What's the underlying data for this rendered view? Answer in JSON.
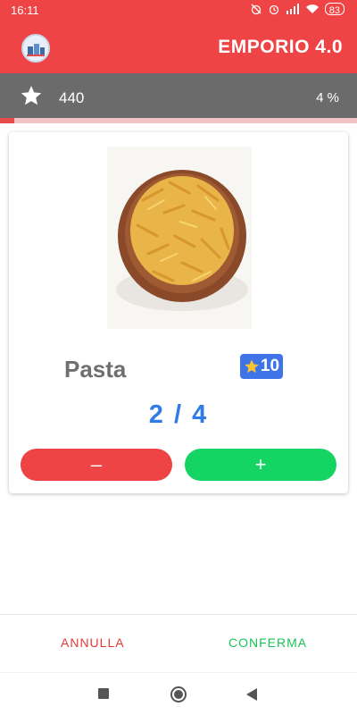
{
  "status_bar": {
    "time": "16:11",
    "battery": "83"
  },
  "app_bar": {
    "title": "EMPORIO 4.0",
    "logo_icon": "emporio-logo-icon"
  },
  "score_bar": {
    "points": "440",
    "percent": "4 %",
    "progress_fraction": 0.04,
    "star_icon": "star-icon"
  },
  "product": {
    "image": "pasta-bowl-image",
    "name": "Pasta",
    "points_badge": "10",
    "quantity": "2 / 4",
    "minus_label": "–",
    "plus_label": "+"
  },
  "footer": {
    "cancel_label": "ANNULLA",
    "confirm_label": "CONFERMA"
  },
  "colors": {
    "primary_red": "#ee4445",
    "score_gray": "#6b6b6b",
    "accent_blue": "#2f7be8",
    "confirm_green": "#14d463"
  }
}
